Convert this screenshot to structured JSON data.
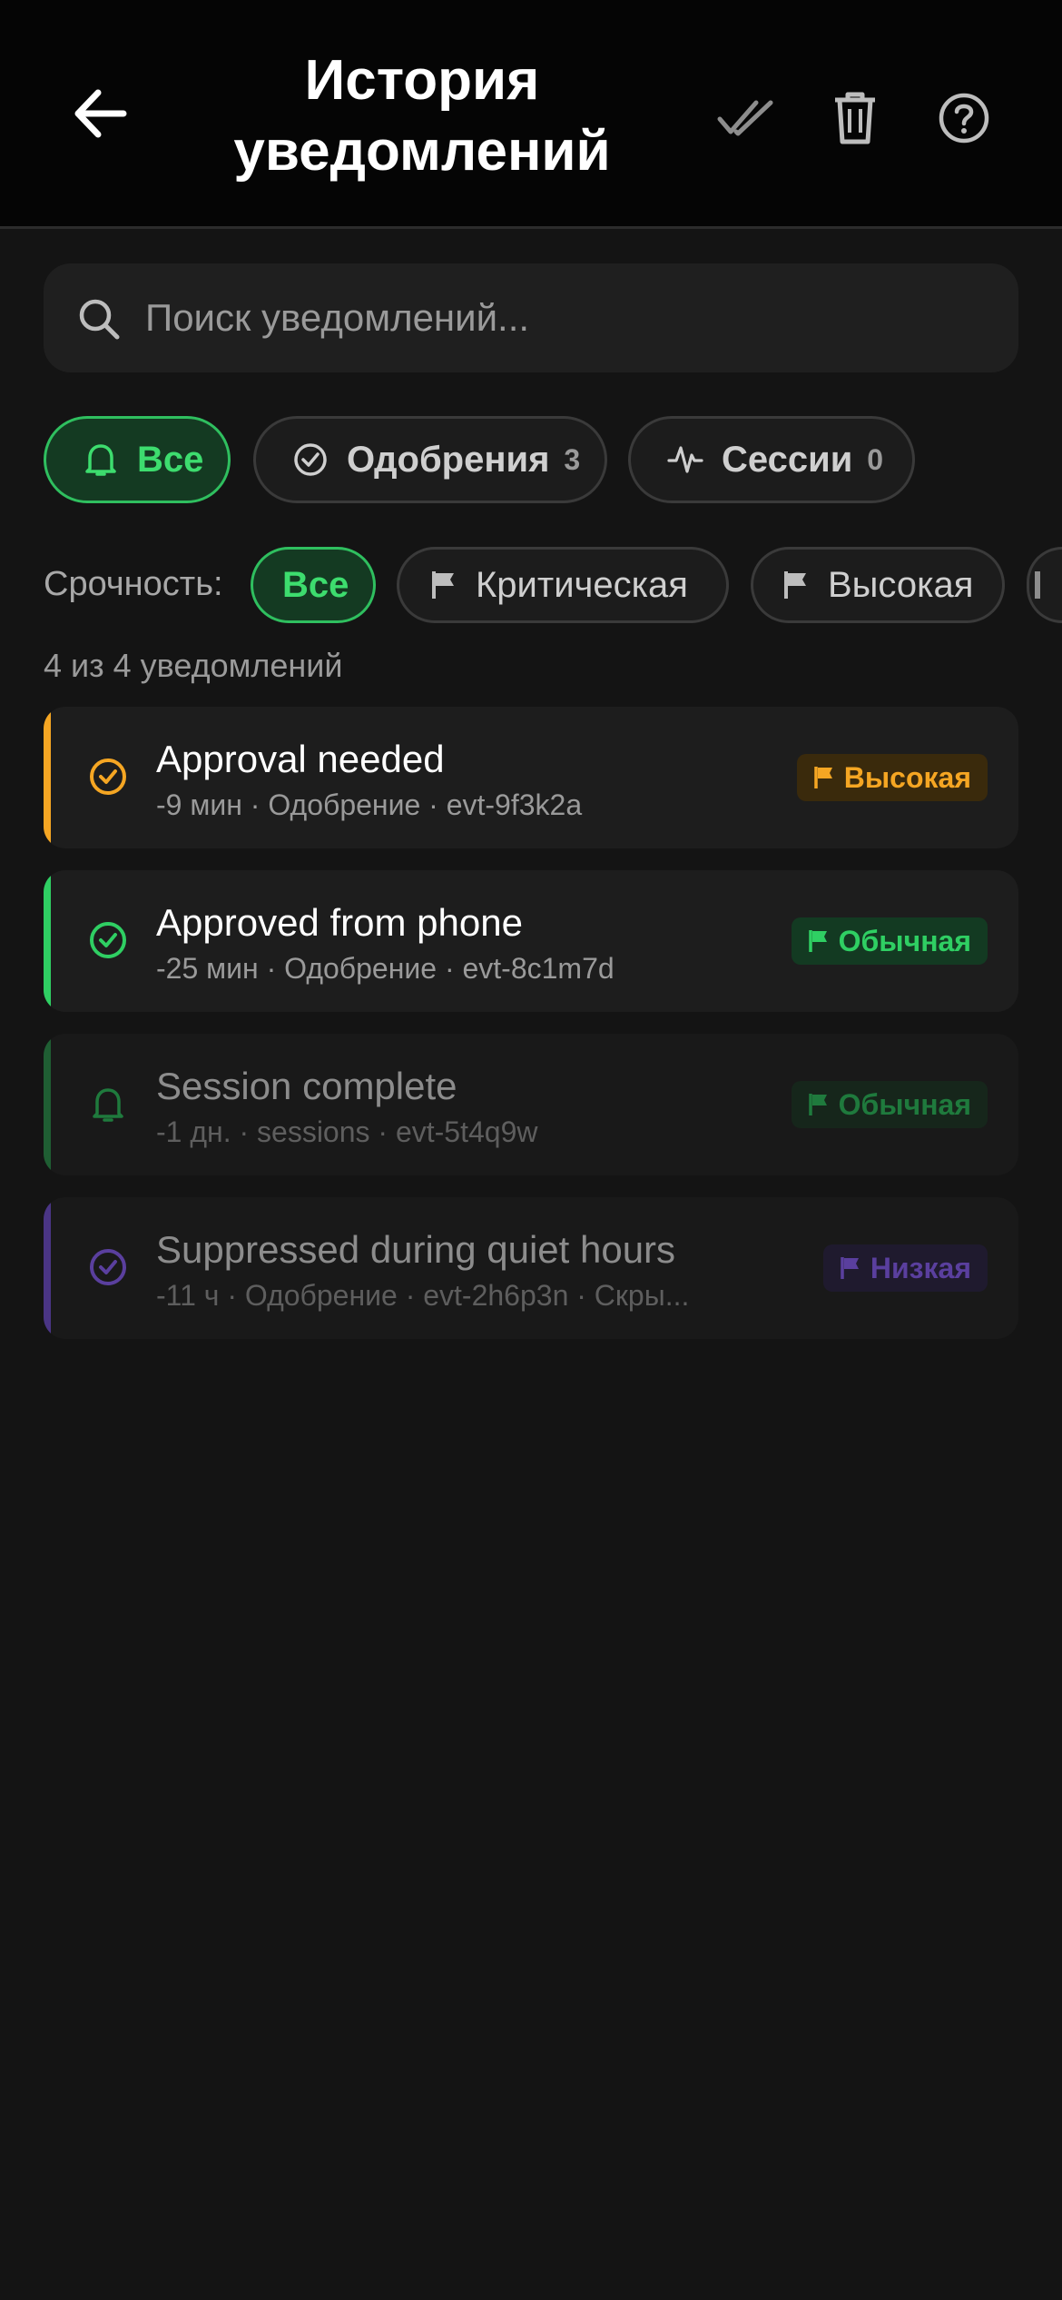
{
  "header": {
    "title": "История уведомлений",
    "back_icon": "arrow-left-icon",
    "actions": [
      "mark-all-read-icon",
      "trash-icon",
      "help-icon"
    ]
  },
  "search": {
    "placeholder": "Поиск уведомлений..."
  },
  "type_filters": [
    {
      "label": "Все",
      "icon": "bell-icon",
      "active": true
    },
    {
      "label": "Одобрения",
      "icon": "check-circle-icon",
      "count": "3",
      "active": false
    },
    {
      "label": "Сессии",
      "icon": "activity-icon",
      "count": "0",
      "active": false
    }
  ],
  "urgency": {
    "label": "Срочность:",
    "options": [
      {
        "label": "Все",
        "active": true
      },
      {
        "label": "Критическая",
        "icon": "flag-icon"
      },
      {
        "label": "Высокая",
        "icon": "flag-icon"
      }
    ]
  },
  "count_text": "4 из 4 уведомлений",
  "notifications": [
    {
      "title": "Approval needed",
      "meta": "-9 мин · Одобрение · evt-9f3k2a",
      "badge": "Высокая",
      "icon": "check-circle-icon",
      "accent": "#f5a623",
      "dim": false
    },
    {
      "title": "Approved from phone",
      "meta": "-25 мин · Одобрение · evt-8c1m7d",
      "badge": "Обычная",
      "icon": "check-circle-icon",
      "accent": "#2fcf63",
      "dim": false
    },
    {
      "title": "Session complete",
      "meta": "-1 дн. · sessions · evt-5t4q9w",
      "badge": "Обычная",
      "icon": "bell-icon",
      "accent": "#1f7a3d",
      "dim": true
    },
    {
      "title": "Suppressed during quiet hours",
      "meta": "-11 ч · Одобрение · evt-2h6p3n · Скры...",
      "badge": "Низкая",
      "icon": "check-circle-icon",
      "accent": "#5a3f9e",
      "dim": true
    }
  ],
  "colors": {
    "accent_green": "#2fbf5f",
    "high": "#f5a623",
    "normal": "#2fcf63",
    "low": "#5a3f9e"
  }
}
